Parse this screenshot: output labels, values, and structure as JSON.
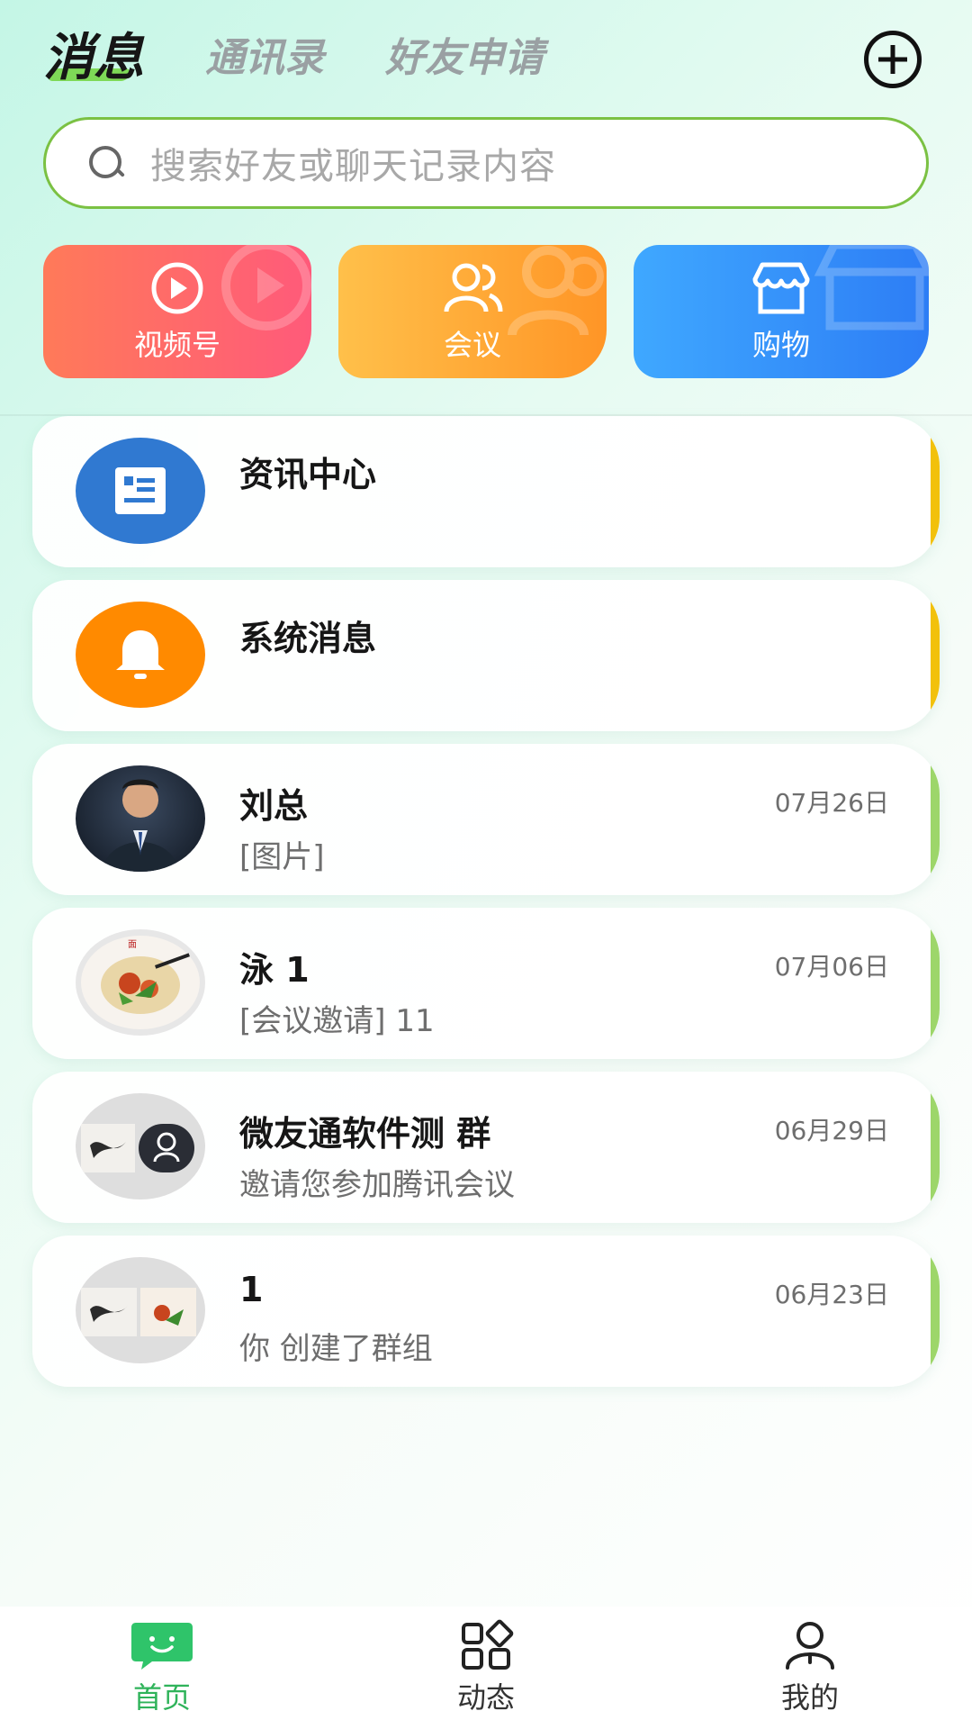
{
  "header": {
    "tabs": [
      {
        "label": "消息"
      },
      {
        "label": "通讯录"
      },
      {
        "label": "好友申请"
      }
    ]
  },
  "search": {
    "placeholder": "搜索好友或聊天记录内容"
  },
  "quick_actions": [
    {
      "label": "视频号",
      "icon": "play-icon",
      "color": "#ff6a66"
    },
    {
      "label": "会议",
      "icon": "users-icon",
      "color": "#ffa83a"
    },
    {
      "label": "购物",
      "icon": "store-icon",
      "color": "#3a95fb"
    }
  ],
  "conversations": [
    {
      "name": "资讯中心",
      "subtitle": "",
      "time": "",
      "avatar": "news-icon"
    },
    {
      "name": "系统消息",
      "subtitle": "",
      "time": "",
      "avatar": "bell-icon"
    },
    {
      "name": "刘总",
      "subtitle": "[图片]",
      "time": "07月26日",
      "avatar": "person-photo"
    },
    {
      "name": "泳 1",
      "subtitle": "[会议邀请] 11",
      "time": "07月06日",
      "avatar": "food-photo"
    },
    {
      "name": "微友通软件测 群",
      "subtitle": "邀请您参加腾讯会议",
      "time": "06月29日",
      "avatar": "group-photo"
    },
    {
      "name": "1",
      "subtitle": "你 创建了群组",
      "time": "06月23日",
      "avatar": "group-photo"
    }
  ],
  "nav": [
    {
      "label": "首页",
      "icon": "chat-icon"
    },
    {
      "label": "动态",
      "icon": "apps-icon"
    },
    {
      "label": "我的",
      "icon": "user-icon"
    }
  ],
  "colors": {
    "accent": "#2fb35a",
    "search_border": "#7bc143"
  }
}
